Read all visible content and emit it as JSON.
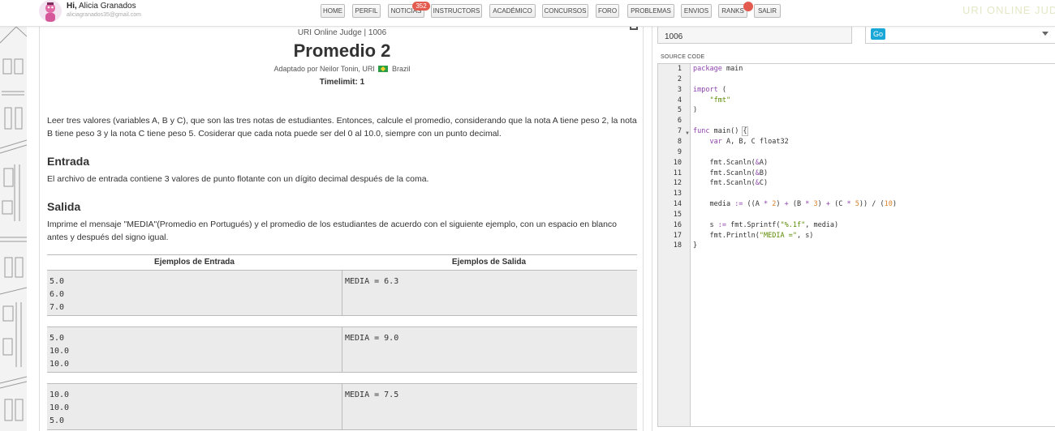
{
  "header": {
    "greeting_prefix": "Hi,",
    "user_name": "Alicia Granados",
    "email": "aliciagranados35@gmail.com",
    "nav": [
      {
        "id": "home",
        "label": "HOME"
      },
      {
        "id": "perfil",
        "label": "PERFIL"
      },
      {
        "id": "noticias",
        "label": "NOTICIAS"
      },
      {
        "id": "instructors",
        "label": "INSTRUCTORS"
      },
      {
        "id": "academico",
        "label": "ACADÉMICO"
      },
      {
        "id": "concursos",
        "label": "CONCURSOS"
      },
      {
        "id": "foro",
        "label": "FORO"
      },
      {
        "id": "problemas",
        "label": "PROBLEMAS"
      },
      {
        "id": "envios",
        "label": "ENVIOS"
      },
      {
        "id": "ranks",
        "label": "RANKS"
      },
      {
        "id": "salir",
        "label": "SALIR"
      }
    ],
    "noticias_badge": "352",
    "brand": "URI ONLINE JUDGE"
  },
  "problem": {
    "source": "URI Online Judge | 1006",
    "title": "Promedio 2",
    "credit": "Adaptado por Neilor Tonin, URI",
    "country": "Brazil",
    "timelimit": "Timelimit: 1",
    "description": "Leer tres valores (variables A, B y C), que son las tres notas de estudiantes. Entonces, calcule el promedio, considerando que la nota A tiene peso 2, la nota B tiene peso 3 y la nota C tiene peso 5. Cosiderar que cada nota puede ser del 0 al 10.0, siempre con un punto decimal.",
    "input_heading": "Entrada",
    "input_text": "El archivo de entrada contiene 3 valores de punto flotante con un dígito decimal después de la coma.",
    "output_heading": "Salida",
    "output_text": "Imprime el mensaje \"MEDIA\"(Promedio en Portugués) y el promedio de los estudiantes de acuerdo con el siguiente ejemplo, con un espacio en blanco antes y después del signo igual.",
    "examples_input_header": "Ejemplos de Entrada",
    "examples_output_header": "Ejemplos de Salida",
    "examples": [
      {
        "input": "5.0\n6.0\n7.0",
        "output": "MEDIA = 6.3"
      },
      {
        "input": "5.0\n10.0\n10.0",
        "output": "MEDIA = 9.0"
      },
      {
        "input": "10.0\n10.0\n5.0",
        "output": "MEDIA = 7.5"
      }
    ]
  },
  "editor": {
    "problem_id": "1006",
    "language": "Go",
    "source_label": "SOURCE CODE",
    "line_numbers": [
      "1",
      "2",
      "3",
      "4",
      "5",
      "6",
      "7",
      "8",
      "9",
      "10",
      "11",
      "12",
      "13",
      "14",
      "15",
      "16",
      "17",
      "18"
    ],
    "colors": {
      "keyword": "#8e44ad",
      "string": "#5a8a00",
      "number": "#d9822b"
    },
    "code": [
      [
        [
          "kw",
          "package"
        ],
        [
          "p",
          " main"
        ]
      ],
      [],
      [
        [
          "kw",
          "import"
        ],
        [
          "p",
          " ("
        ]
      ],
      [
        [
          "p",
          "    "
        ],
        [
          "str",
          "\"fmt\""
        ]
      ],
      [
        [
          "p",
          ")"
        ]
      ],
      [],
      [
        [
          "kw",
          "func"
        ],
        [
          "p",
          " main() "
        ],
        [
          "brace",
          "{"
        ]
      ],
      [
        [
          "p",
          "    "
        ],
        [
          "kw",
          "var"
        ],
        [
          "p",
          " A, B, C float32"
        ]
      ],
      [],
      [
        [
          "p",
          "    fmt.Scanln("
        ],
        [
          "kw",
          "&"
        ],
        [
          "p",
          "A)"
        ]
      ],
      [
        [
          "p",
          "    fmt.Scanln("
        ],
        [
          "kw",
          "&"
        ],
        [
          "p",
          "B)"
        ]
      ],
      [
        [
          "p",
          "    fmt.Scanln("
        ],
        [
          "kw",
          "&"
        ],
        [
          "p",
          "C)"
        ]
      ],
      [],
      [
        [
          "p",
          "    media "
        ],
        [
          "kw",
          ":="
        ],
        [
          "p",
          " ((A "
        ],
        [
          "kw",
          "*"
        ],
        [
          "p",
          " "
        ],
        [
          "num",
          "2"
        ],
        [
          "p",
          ") "
        ],
        [
          "kw",
          "+"
        ],
        [
          "p",
          " (B "
        ],
        [
          "kw",
          "*"
        ],
        [
          "p",
          " "
        ],
        [
          "num",
          "3"
        ],
        [
          "p",
          ") "
        ],
        [
          "kw",
          "+"
        ],
        [
          "p",
          " (C "
        ],
        [
          "kw",
          "*"
        ],
        [
          "p",
          " "
        ],
        [
          "num",
          "5"
        ],
        [
          "p",
          ")) / ("
        ],
        [
          "num",
          "10"
        ],
        [
          "p",
          ")"
        ]
      ],
      [],
      [
        [
          "p",
          "    s "
        ],
        [
          "kw",
          ":="
        ],
        [
          "p",
          " fmt.Sprintf("
        ],
        [
          "str",
          "\"%.1f\""
        ],
        [
          "p",
          ", media)"
        ]
      ],
      [
        [
          "p",
          "    fmt.Println("
        ],
        [
          "str",
          "\"MEDIA =\""
        ],
        [
          "p",
          ", s)"
        ]
      ],
      [
        [
          "p",
          "}"
        ]
      ]
    ]
  }
}
